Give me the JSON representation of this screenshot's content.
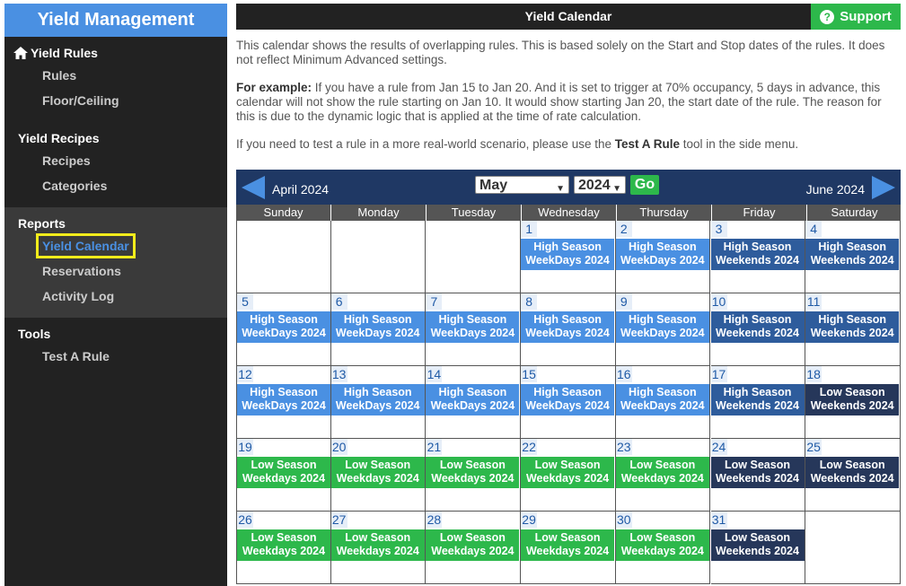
{
  "sidebar": {
    "title": "Yield Management",
    "sections": [
      {
        "heading": "Yield Rules",
        "items": [
          "Rules",
          "Floor/Ceiling"
        ]
      },
      {
        "heading": "Yield Recipes",
        "items": [
          "Recipes",
          "Categories"
        ]
      },
      {
        "heading": "Reports",
        "items": [
          "Yield Calendar",
          "Reservations",
          "Activity Log"
        ]
      },
      {
        "heading": "Tools",
        "items": [
          "Test A Rule"
        ]
      }
    ]
  },
  "topbar": {
    "title": "Yield Calendar",
    "support_label": "Support"
  },
  "description": {
    "p1": "This calendar shows the results of overlapping rules. This is based solely on the Start and Stop dates of the rules. It does not reflect Minimum Advanced settings.",
    "p2_label": "For example:",
    "p2_text": " If you have a rule from Jan 15 to Jan 20. And it is set to trigger at 70% occupancy, 5 days in advance, this calendar will not show the rule starting on Jan 10. It would show starting Jan 20, the start date of the rule. The reason for this is due to the dynamic logic that is applied at the time of rate calculation.",
    "p3_pre": "If you need to test a rule in a more real-world scenario, please use the ",
    "p3_bold": "Test A Rule",
    "p3_post": " tool in the side menu."
  },
  "calendar": {
    "prev_label": "April 2024",
    "next_label": "June 2024",
    "month_value": "May",
    "year_value": "2024",
    "go_label": "Go",
    "weekdays": [
      "Sunday",
      "Monday",
      "Tuesday",
      "Wednesday",
      "Thursday",
      "Friday",
      "Saturday"
    ],
    "event_colors": {
      "High Season WeekDays 2024": "#4a90e2",
      "High Season Weekends 2024": "#2e5c9c",
      "Low Season Weekdays 2024": "#2db84b",
      "Low Season Weekends 2024": "#26375a"
    },
    "first_weekday": 3,
    "days": [
      {
        "day": "1",
        "event": "High Season WeekDays 2024"
      },
      {
        "day": "2",
        "event": "High Season WeekDays 2024"
      },
      {
        "day": "3",
        "event": "High Season Weekends 2024"
      },
      {
        "day": "4",
        "event": "High Season Weekends 2024"
      },
      {
        "day": "5",
        "event": "High Season WeekDays 2024"
      },
      {
        "day": "6",
        "event": "High Season WeekDays 2024"
      },
      {
        "day": "7",
        "event": "High Season WeekDays 2024"
      },
      {
        "day": "8",
        "event": "High Season WeekDays 2024"
      },
      {
        "day": "9",
        "event": "High Season WeekDays 2024"
      },
      {
        "day": "10",
        "event": "High Season Weekends 2024"
      },
      {
        "day": "11",
        "event": "High Season Weekends 2024"
      },
      {
        "day": "12",
        "event": "High Season WeekDays 2024"
      },
      {
        "day": "13",
        "event": "High Season WeekDays 2024"
      },
      {
        "day": "14",
        "event": "High Season WeekDays 2024"
      },
      {
        "day": "15",
        "event": "High Season WeekDays 2024"
      },
      {
        "day": "16",
        "event": "High Season WeekDays 2024"
      },
      {
        "day": "17",
        "event": "High Season Weekends 2024"
      },
      {
        "day": "18",
        "event": "Low Season Weekends 2024"
      },
      {
        "day": "19",
        "event": "Low Season Weekdays 2024"
      },
      {
        "day": "20",
        "event": "Low Season Weekdays 2024"
      },
      {
        "day": "21",
        "event": "Low Season Weekdays 2024"
      },
      {
        "day": "22",
        "event": "Low Season Weekdays 2024"
      },
      {
        "day": "23",
        "event": "Low Season Weekdays 2024"
      },
      {
        "day": "24",
        "event": "Low Season Weekends 2024"
      },
      {
        "day": "25",
        "event": "Low Season Weekends 2024"
      },
      {
        "day": "26",
        "event": "Low Season Weekdays 2024"
      },
      {
        "day": "27",
        "event": "Low Season Weekdays 2024"
      },
      {
        "day": "28",
        "event": "Low Season Weekdays 2024"
      },
      {
        "day": "29",
        "event": "Low Season Weekdays 2024"
      },
      {
        "day": "30",
        "event": "Low Season Weekdays 2024"
      },
      {
        "day": "31",
        "event": "Low Season Weekends 2024"
      }
    ]
  }
}
